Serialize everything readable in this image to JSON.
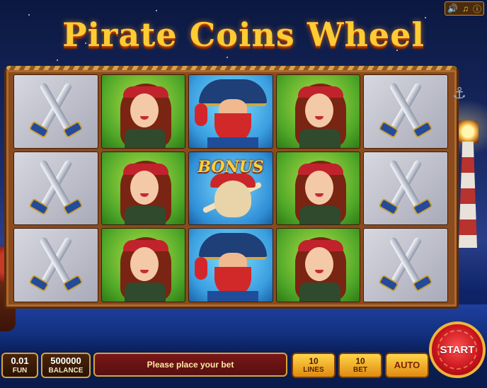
{
  "title": "Pirate Coins Wheel",
  "top_controls": {
    "sound_icon": "speaker-icon",
    "music_icon": "music-note-icon",
    "info_icon": "info-icon"
  },
  "reels": [
    [
      "crossed-swords",
      "pirate-lady",
      "pirate-captain",
      "pirate-lady",
      "crossed-swords"
    ],
    [
      "crossed-swords",
      "pirate-lady",
      "bonus-skull",
      "pirate-lady",
      "crossed-swords"
    ],
    [
      "crossed-swords",
      "pirate-lady",
      "pirate-captain",
      "pirate-lady",
      "crossed-swords"
    ]
  ],
  "bonus_symbol_label": "BONUS",
  "bottom_bar": {
    "coin_value": "0.01",
    "coin_label": "FUN",
    "balance_value": "500000",
    "balance_label": "BALANCE",
    "message": "Please place your bet",
    "lines_value": "10",
    "lines_label": "LINES",
    "bet_value": "10",
    "bet_label": "BET",
    "auto_label": "AUTO",
    "start_label": "START"
  },
  "colors": {
    "title": "#ffcc33",
    "frame": "#8a4b1e",
    "start_button": "#c4121a",
    "accent_gold": "#d6a43a"
  }
}
